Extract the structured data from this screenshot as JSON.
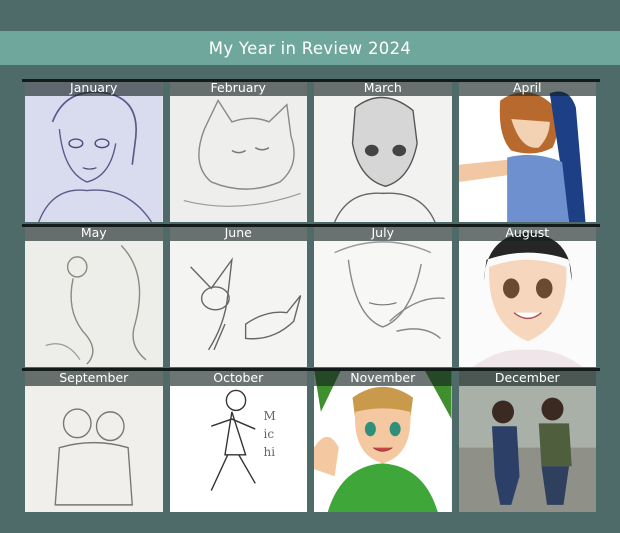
{
  "title": "My Year in Review 2024",
  "months": [
    {
      "label": "January",
      "art": "sketch-girl-portrait"
    },
    {
      "label": "February",
      "art": "sketch-sleeping-cat"
    },
    {
      "label": "March",
      "art": "sketch-boy-hoodie"
    },
    {
      "label": "April",
      "art": "color-girl-blue-ribbon"
    },
    {
      "label": "May",
      "art": "sketch-mermaid"
    },
    {
      "label": "June",
      "art": "sketch-fennec-foxes"
    },
    {
      "label": "July",
      "art": "sketch-face-hand-chin"
    },
    {
      "label": "August",
      "art": "color-girl-smiling"
    },
    {
      "label": "September",
      "art": "sketch-hugging-pair"
    },
    {
      "label": "October",
      "art": "ink-running-girl-michi"
    },
    {
      "label": "November",
      "art": "color-boy-green-shirt"
    },
    {
      "label": "December",
      "art": "color-two-kids-running"
    }
  ],
  "october_signature": "Michi",
  "colors": {
    "background": "#4f6b69",
    "banner": "#6fa79c",
    "label_bar": "#12201e"
  }
}
